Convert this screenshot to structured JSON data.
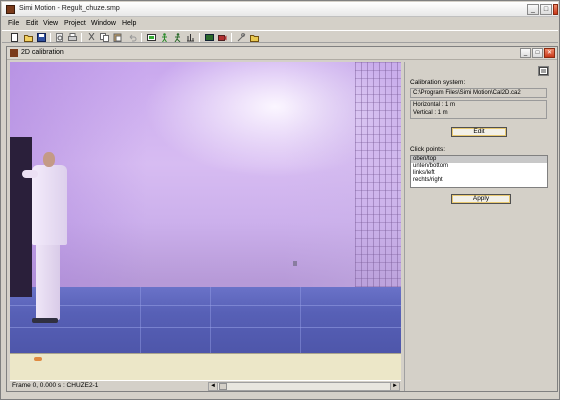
{
  "window": {
    "title": "Simi Motion - Regult_chuze.smp",
    "minimize": "_",
    "maximize": "□",
    "close": "✕"
  },
  "menu": [
    "File",
    "Edit",
    "View",
    "Project",
    "Window",
    "Help"
  ],
  "toolbar": {
    "icons": [
      "new-icon",
      "open-icon",
      "save-icon",
      "print-preview-icon",
      "print-icon",
      "cut-icon",
      "copy-icon",
      "paste-icon",
      "undo-icon",
      "video-icon",
      "person-icon",
      "walk-icon",
      "stats-icon",
      "camera-icon",
      "record-icon",
      "settings-icon",
      "folder-icon"
    ]
  },
  "child_window": {
    "title": "2D calibration",
    "minimize": "_",
    "maximize": "□",
    "close": "✕"
  },
  "statusbar": {
    "text": "Frame 0, 0.000 s : CHUZE2-1",
    "left_arrow": "◄",
    "right_arrow": "►"
  },
  "calibration": {
    "system_label": "Calibration system:",
    "path": "C:\\Program Files\\Simi Motion\\Cal2D.ca2",
    "horizontal": "Horizontal : 1 m",
    "vertical": "Vertical : 1 m",
    "edit_button": "Edit",
    "click_points_label": "Click points:",
    "points": [
      "oben/top",
      "unten/bottom",
      "links/left",
      "rechts/right"
    ],
    "selected_point": 0,
    "apply_button": "Apply"
  },
  "colors": {
    "selection": "#c8c8c8",
    "wall": "#d7bcf2",
    "floor": "#5760b6"
  }
}
